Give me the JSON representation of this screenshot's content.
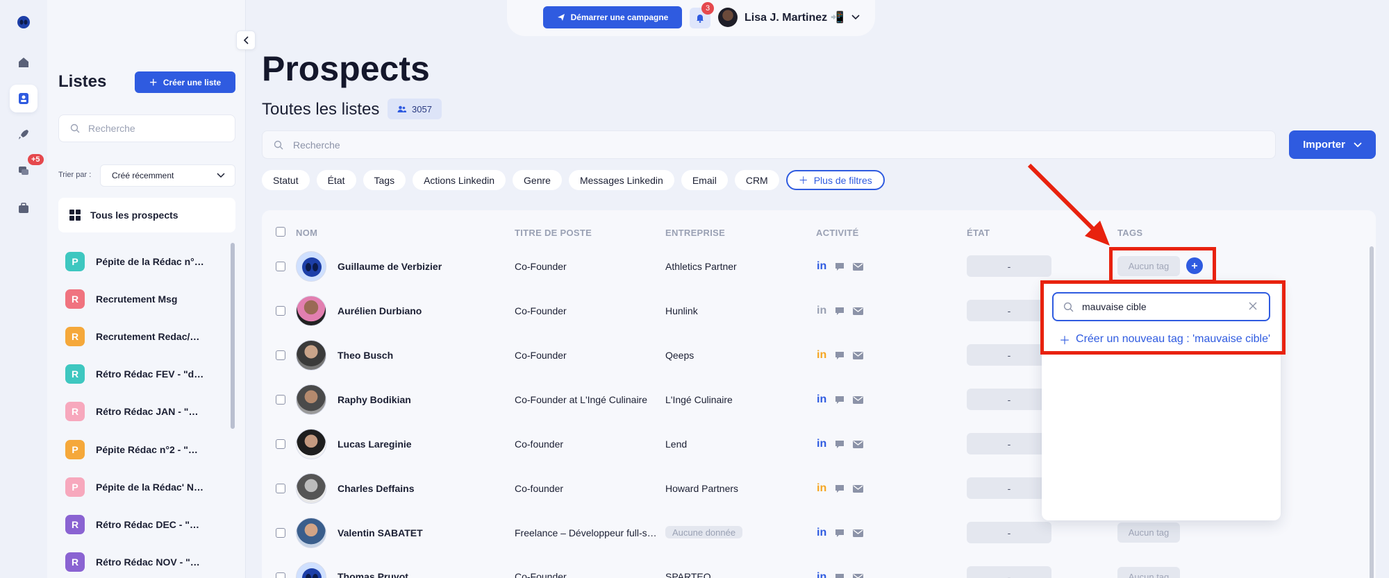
{
  "topbar": {
    "campaign_label": "Démarrer une campagne",
    "notif_count": "3",
    "user_name": "Lisa J. Martinez 📲"
  },
  "sidebar": {
    "title": "Listes",
    "create_label": "Créer une liste",
    "search_placeholder": "Recherche",
    "sort_label": "Trier par :",
    "sort_value": "Créé récemment",
    "all_prospects": "Tous les prospects",
    "rail_badge": "+5",
    "lists": [
      {
        "letter": "P",
        "color": "#3ec7c0",
        "name": "Pépite de la Rédac n°…"
      },
      {
        "letter": "R",
        "color": "#f0737f",
        "name": "Recrutement Msg"
      },
      {
        "letter": "R",
        "color": "#f5a83a",
        "name": "Recrutement Redac/…"
      },
      {
        "letter": "R",
        "color": "#3ec7c0",
        "name": "Rétro Rédac FEV - \"d…"
      },
      {
        "letter": "R",
        "color": "#f7a8bd",
        "name": "Rétro Rédac JAN - \"…"
      },
      {
        "letter": "P",
        "color": "#f5a83a",
        "name": "Pépite Rédac n°2 - \"…"
      },
      {
        "letter": "P",
        "color": "#f7a8bd",
        "name": "Pépite de la Rédac' N…"
      },
      {
        "letter": "R",
        "color": "#8a63d2",
        "name": "Rétro Rédac DEC - \"…"
      },
      {
        "letter": "R",
        "color": "#8a63d2",
        "name": "Rétro Rédac NOV - \"…"
      }
    ]
  },
  "main": {
    "title": "Prospects",
    "subtitle": "Toutes les listes",
    "count": "3057",
    "search_placeholder": "Recherche",
    "import_label": "Importer",
    "filters": [
      "Statut",
      "État",
      "Tags",
      "Actions Linkedin",
      "Genre",
      "Messages Linkedin",
      "Email",
      "CRM"
    ],
    "more_filters": "Plus de filtres"
  },
  "table": {
    "headers": {
      "name": "NOM",
      "title": "TITRE DE POSTE",
      "company": "ENTREPRISE",
      "activity": "ACTIVITÉ",
      "state": "ÉTAT",
      "tags": "TAGS"
    },
    "rows": [
      {
        "name": "Guillaume de Verbizier",
        "title": "Co-Founder",
        "company": "Athletics Partner",
        "state": "-",
        "tags": "Aucun tag",
        "linkedin_color": "#2f5be0"
      },
      {
        "name": "Aurélien Durbiano",
        "title": "Co-Founder",
        "company": "Hunlink",
        "state": "-",
        "tags": "",
        "linkedin_color": "#9aa1b4"
      },
      {
        "name": "Theo Busch",
        "title": "Co-Founder",
        "company": "Qeeps",
        "state": "-",
        "tags": "",
        "linkedin_color": "#f5a623"
      },
      {
        "name": "Raphy Bodikian",
        "title": "Co-Founder at L'Ingé Culinaire",
        "company": "L'Ingé Culinaire",
        "state": "-",
        "tags": "",
        "linkedin_color": "#2f5be0"
      },
      {
        "name": "Lucas Lareginie",
        "title": "Co-founder",
        "company": "Lend",
        "state": "-",
        "tags": "",
        "linkedin_color": "#2f5be0"
      },
      {
        "name": "Charles Deffains",
        "title": "Co-founder",
        "company": "Howard Partners",
        "state": "-",
        "tags": "",
        "linkedin_color": "#f5a623"
      },
      {
        "name": "Valentin SABATET",
        "title": "Freelance – Développeur full-s…",
        "company": "Aucune donnée",
        "state": "-",
        "tags": "Aucun tag",
        "linkedin_color": "#2f5be0"
      },
      {
        "name": "Thomas Pruvot",
        "title": "Co-Founder",
        "company": "SPARTEO",
        "state": "-",
        "tags": "Aucun tag",
        "linkedin_color": "#2f5be0"
      }
    ]
  },
  "tag_dropdown": {
    "query": "mauvaise cible",
    "create_option": "Créer un nouveau tag : 'mauvaise cible'"
  },
  "colors": {
    "accent": "#2f5be0",
    "annotation": "#e8220e"
  }
}
